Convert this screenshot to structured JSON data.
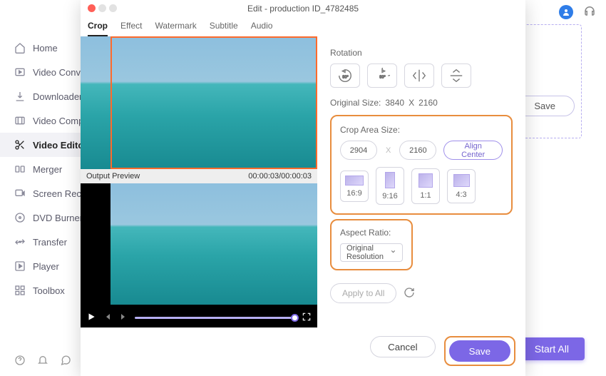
{
  "app": {
    "window_title": "Edit - production ID_4782485"
  },
  "sidebar": {
    "items": [
      {
        "label": "Home"
      },
      {
        "label": "Video Convert"
      },
      {
        "label": "Downloader"
      },
      {
        "label": "Video Compre"
      },
      {
        "label": "Video Editor"
      },
      {
        "label": "Merger"
      },
      {
        "label": "Screen Record"
      },
      {
        "label": "DVD Burner"
      },
      {
        "label": "Transfer"
      },
      {
        "label": "Player"
      },
      {
        "label": "Toolbox"
      }
    ]
  },
  "top_right": {
    "save_bg_label": "Save",
    "start_all_label": "Start All"
  },
  "tabs": [
    {
      "label": "Crop"
    },
    {
      "label": "Effect"
    },
    {
      "label": "Watermark"
    },
    {
      "label": "Subtitle"
    },
    {
      "label": "Audio"
    }
  ],
  "preview": {
    "output_label": "Output Preview",
    "timecode": "00:00:03/00:00:03"
  },
  "rotation": {
    "label": "Rotation"
  },
  "original_size": {
    "label": "Original Size:",
    "w": "3840",
    "x": "X",
    "h": "2160"
  },
  "crop_area": {
    "label": "Crop Area Size:",
    "w": "2904",
    "x": "X",
    "h": "2160",
    "align_center": "Align Center",
    "ratios": [
      "16:9",
      "9:16",
      "1:1",
      "4:3"
    ]
  },
  "aspect": {
    "label": "Aspect Ratio:",
    "value": "Original Resolution"
  },
  "apply_all": {
    "label": "Apply to All"
  },
  "footer": {
    "cancel": "Cancel",
    "save": "Save"
  }
}
